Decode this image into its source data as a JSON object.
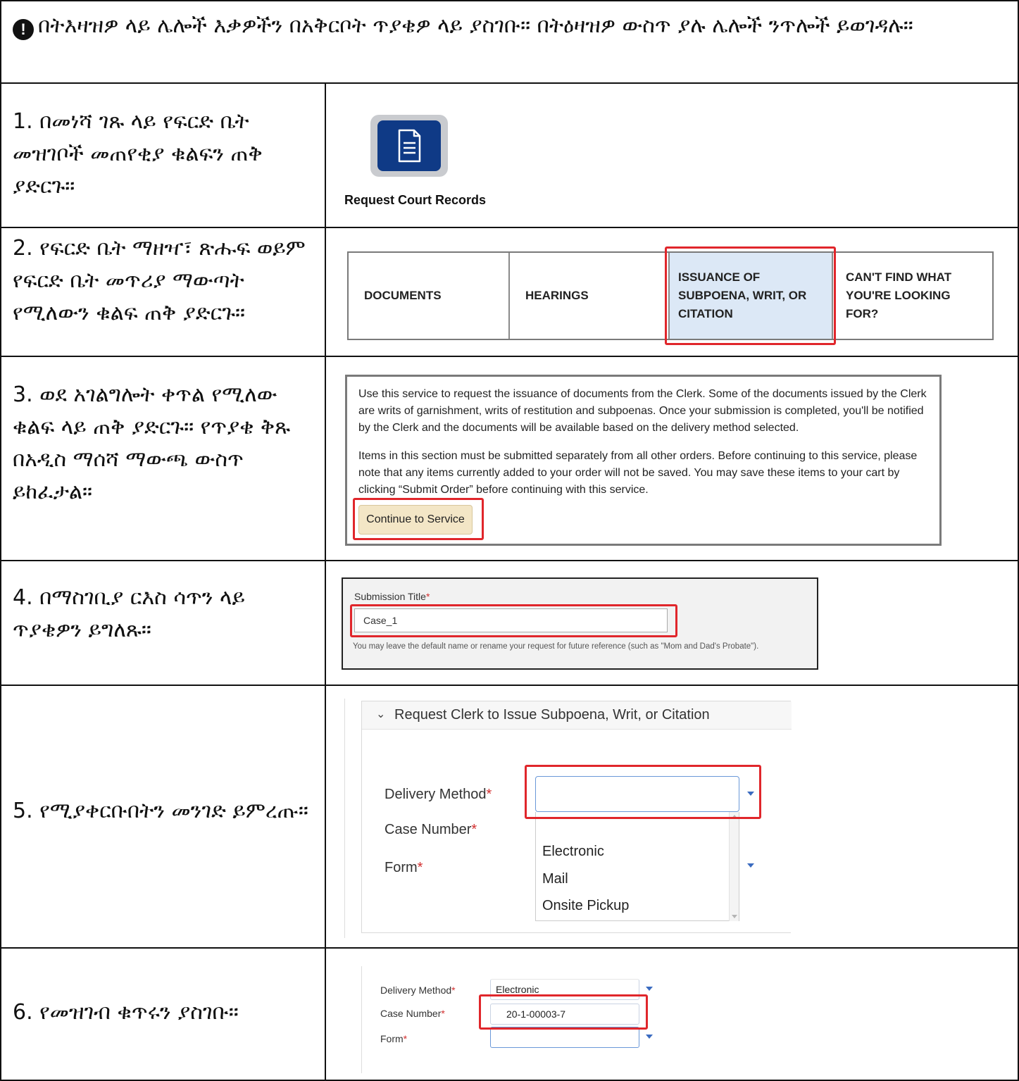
{
  "notice": {
    "icon": "exclamation-circle-icon",
    "text": "በትእዛዝዎ ላይ ሌሎች እቃዎችን በአቅርቦት ጥያቄዎ ላይ ያስገቡ። በትዕዛዝዎ ውስጥ ያሉ ሌሎች ንጥሎች ይወገዳሉ።"
  },
  "steps": [
    "1. በመነሻ ገጹ ላይ የፍርድ ቤት መዝገቦች መጠየቂያ ቁልፍን ጠቅ ያድርጉ።",
    "2. የፍርድ ቤት ማዘዣ፣ ጽሑፍ ወይም የፍርድ ቤት መጥሪያ ማውጣት የሚለውን ቁልፍ ጠቅ ያድርጉ።",
    "3. ወደ አገልግሎት ቀጥል የሚለው ቁልፍ ላይ ጠቅ ያድርጉ። የጥያቄ ቅጹ በአዲስ ማሰሻ ማውጫ ውስጥ ይከፈታል።",
    "4. በማስገቢያ ርእስ ሳጥን ላይ ጥያቄዎን ይግለጹ።",
    "5. የሚያቀርቡበትን መንገድ ይምረጡ።",
    "6. የመዝገብ ቁጥሩን ያስገቡ።"
  ],
  "row1": {
    "app_icon": "document-icon",
    "caption": "Request Court Records"
  },
  "row2": {
    "tabs": [
      "DOCUMENTS",
      "HEARINGS",
      "ISSUANCE OF SUBPOENA, WRIT, OR CITATION",
      "CAN'T FIND WHAT YOU'RE LOOKING FOR?"
    ]
  },
  "row3": {
    "paragraph1": "Use this service to request the issuance of documents from the Clerk. Some of the documents issued by the Clerk are writs of garnishment, writs of restitution and subpoenas. Once your submission is completed, you'll be notified by the Clerk and the documents will be available based on the delivery method selected.",
    "paragraph2": "Items in this section must be submitted separately from all other orders. Before continuing to this service, please note that any items currently added to your order will not be saved. You may save these items to your cart by clicking “Submit Order” before continuing with this service.",
    "button": "Continue to Service"
  },
  "row4": {
    "label": "Submission Title",
    "required_mark": "*",
    "value": "Case_1",
    "hint": "You may leave the default name or rename your request for future reference (such as \"Mom and Dad's Probate\")."
  },
  "row5": {
    "section_title": "Request Clerk to Issue Subpoena, Writ, or Citation",
    "labels": [
      "Delivery Method",
      "Case Number",
      "Form"
    ],
    "required_mark": "*",
    "delivery_value": "",
    "options": [
      "Electronic",
      "Mail",
      "Onsite Pickup"
    ]
  },
  "row6": {
    "labels": [
      "Delivery Method",
      "Case Number",
      "Form"
    ],
    "required_mark": "*",
    "delivery_value": "Electronic",
    "case_number": "20-1-00003-7",
    "form_value": ""
  },
  "colors": {
    "highlight": "#e0262b",
    "app_blue": "#0f3a86",
    "selected_tab": "#dce8f6",
    "continue_button": "#f3e6c6",
    "required": "#d32f2f"
  }
}
